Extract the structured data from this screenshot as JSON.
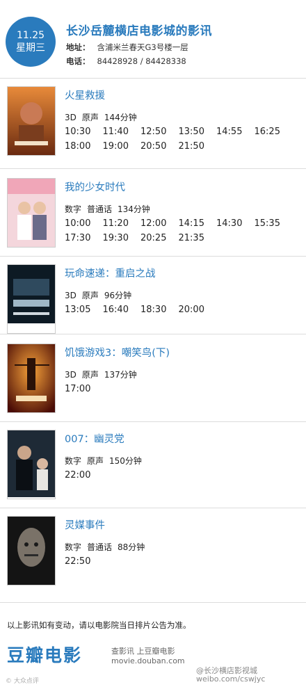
{
  "header": {
    "date": "11.25",
    "weekday": "星期三",
    "title": "长沙岳麓横店电影城的影讯",
    "address_label": "地址：",
    "address": "含浦米兰春天G3号楼一层",
    "phone_label": "电话：",
    "phone": "84428928 / 84428338"
  },
  "movies": [
    {
      "title": "火星救援",
      "format": "3D",
      "language": "原声",
      "duration": "144分钟",
      "times": [
        "10:30",
        "11:40",
        "12:50",
        "13:50",
        "14:55",
        "16:25",
        "18:00",
        "19:00",
        "20:50",
        "21:50"
      ]
    },
    {
      "title": "我的少女时代",
      "format": "数字",
      "language": "普通话",
      "duration": "134分钟",
      "times": [
        "10:00",
        "11:20",
        "12:00",
        "14:15",
        "14:30",
        "15:35",
        "17:30",
        "19:30",
        "20:25",
        "21:35"
      ]
    },
    {
      "title": "玩命速递：重启之战",
      "format": "3D",
      "language": "原声",
      "duration": "96分钟",
      "times": [
        "13:05",
        "16:40",
        "18:30",
        "20:00"
      ]
    },
    {
      "title": "饥饿游戏3：嘲笑鸟(下)",
      "format": "3D",
      "language": "原声",
      "duration": "137分钟",
      "times": [
        "17:00"
      ]
    },
    {
      "title": "007：幽灵党",
      "format": "数字",
      "language": "原声",
      "duration": "150分钟",
      "times": [
        "22:00"
      ]
    },
    {
      "title": "灵媒事件",
      "format": "数字",
      "language": "普通话",
      "duration": "88分钟",
      "times": [
        "22:50"
      ]
    }
  ],
  "notice": "以上影讯如有变动，请以电影院当日排片公告为准。",
  "footer": {
    "brand": "豆瓣电影",
    "slogan": "查影讯  上豆瓣电影",
    "site": "movie.douban.com",
    "watermark_left": "© 大众点评",
    "watermark_right": "@长沙横店影视城",
    "watermark_right2": "weibo.com/cswjyc"
  },
  "colors": {
    "accent": "#2a7bbd"
  }
}
